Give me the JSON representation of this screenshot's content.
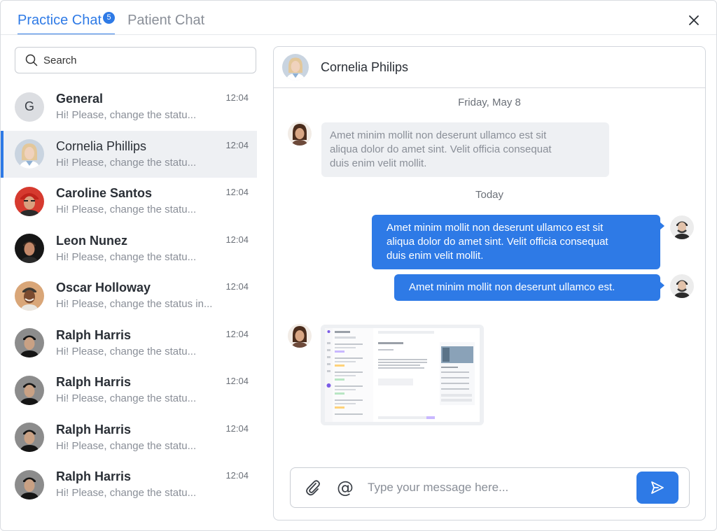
{
  "tabs": [
    {
      "label": "Practice Chat",
      "badge": "5",
      "active": true
    },
    {
      "label": "Patient Chat",
      "active": false
    }
  ],
  "search": {
    "placeholder": "Search"
  },
  "chats": [
    {
      "name": "General",
      "preview": "Hi! Please, change the statu...",
      "time": "12:04",
      "avatar_letter": "G"
    },
    {
      "name": "Cornelia Phillips",
      "preview": "Hi! Please, change the statu...",
      "time": "12:04"
    },
    {
      "name": "Caroline Santos",
      "preview": "Hi! Please, change the statu...",
      "time": "12:04"
    },
    {
      "name": "Leon Nunez",
      "preview": "Hi! Please, change the statu...",
      "time": "12:04"
    },
    {
      "name": "Oscar Holloway",
      "preview": "Hi! Please, change the status in...",
      "time": "12:04"
    },
    {
      "name": "Ralph Harris",
      "preview": "Hi! Please, change the statu...",
      "time": "12:04"
    },
    {
      "name": "Ralph Harris",
      "preview": "Hi! Please, change the statu...",
      "time": "12:04"
    },
    {
      "name": "Ralph Harris",
      "preview": "Hi! Please, change the statu...",
      "time": "12:04"
    },
    {
      "name": "Ralph Harris",
      "preview": "Hi! Please, change the statu...",
      "time": "12:04"
    }
  ],
  "conversation": {
    "title": "Cornelia Philips",
    "date_1": "Friday, May 8",
    "incoming_1": [
      "Amet minim mollit non deserunt ullamco est sit",
      "aliqua dolor do amet sint. Velit officia consequat",
      "duis enim velit mollit."
    ],
    "date_2": "Today",
    "outgoing_1": [
      "Amet minim mollit non deserunt ullamco est sit",
      "aliqua dolor do amet sint. Velit officia consequat",
      "duis enim velit mollit."
    ],
    "outgoing_2": "Amet minim mollit non deserunt ullamco est."
  },
  "composer": {
    "placeholder": "Type your message here..."
  },
  "colors": {
    "accent": "#2e7ae6",
    "muted_text": "#8a8f98",
    "bubble_in": "#eef0f3"
  }
}
